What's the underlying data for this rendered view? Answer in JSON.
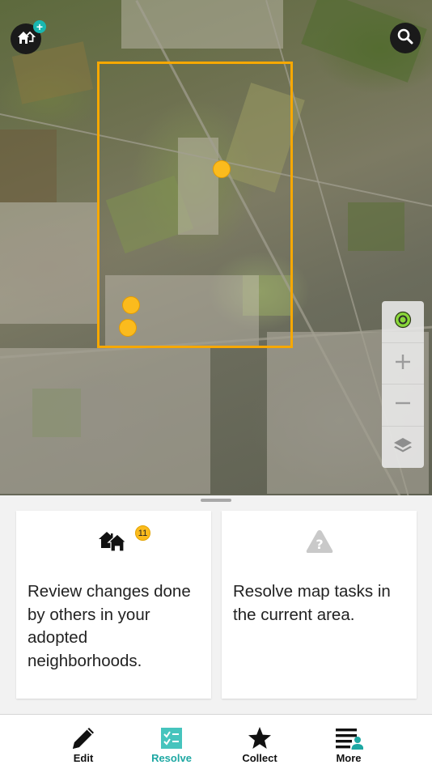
{
  "colors": {
    "aoi_outline": "#f7a800",
    "marker": "#fbbb1d",
    "accent": "#1ea8a3",
    "badge": "#fbbb1d"
  },
  "map": {
    "icons": {
      "adopt": "house-plus-icon",
      "search": "search-icon",
      "locate": "locate-icon",
      "zoom_in": "plus-icon",
      "zoom_out": "minus-icon",
      "layers": "layers-icon"
    }
  },
  "cards": [
    {
      "icon": "neighborhood-houses-icon",
      "badge": "11",
      "text": "Review changes done by others in your adopted neighborhoods."
    },
    {
      "icon": "question-triangle-icon",
      "text": "Resolve map tasks in the current area."
    }
  ],
  "tabs": [
    {
      "label": "Edit",
      "icon": "pencil-icon"
    },
    {
      "label": "Resolve",
      "icon": "resolve-checklist-icon",
      "active": true
    },
    {
      "label": "Collect",
      "icon": "star-icon"
    },
    {
      "label": "More",
      "icon": "menu-user-icon"
    }
  ]
}
